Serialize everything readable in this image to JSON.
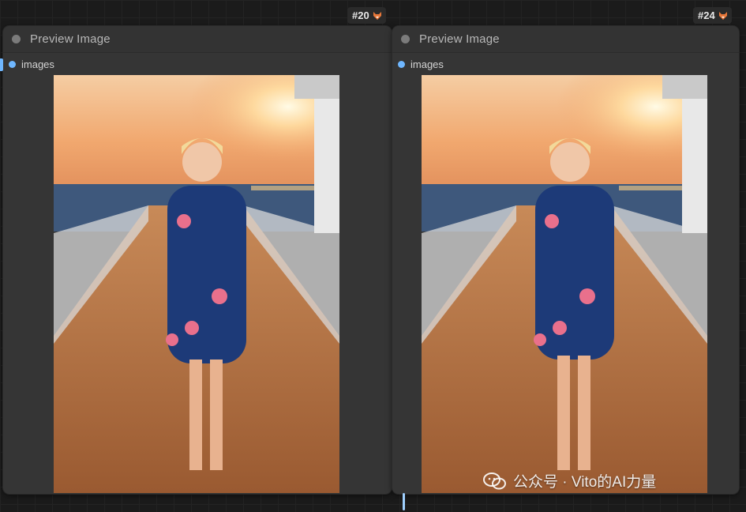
{
  "nodes": [
    {
      "id": "#20",
      "title": "Preview Image",
      "output_label": "images"
    },
    {
      "id": "#24",
      "title": "Preview Image",
      "output_label": "images"
    }
  ],
  "watermark": {
    "text": "公众号 · Vito的AI力量"
  },
  "colors": {
    "canvas": "#1b1b1b",
    "node_body": "#353535",
    "socket": "#6fb7ff",
    "sunset_sky": "#f3b177",
    "sea": "#3a5478",
    "deck": "#b06c3c",
    "dress": "#1d3a78"
  },
  "icons": [
    "fox-icon",
    "wechat-icon"
  ]
}
